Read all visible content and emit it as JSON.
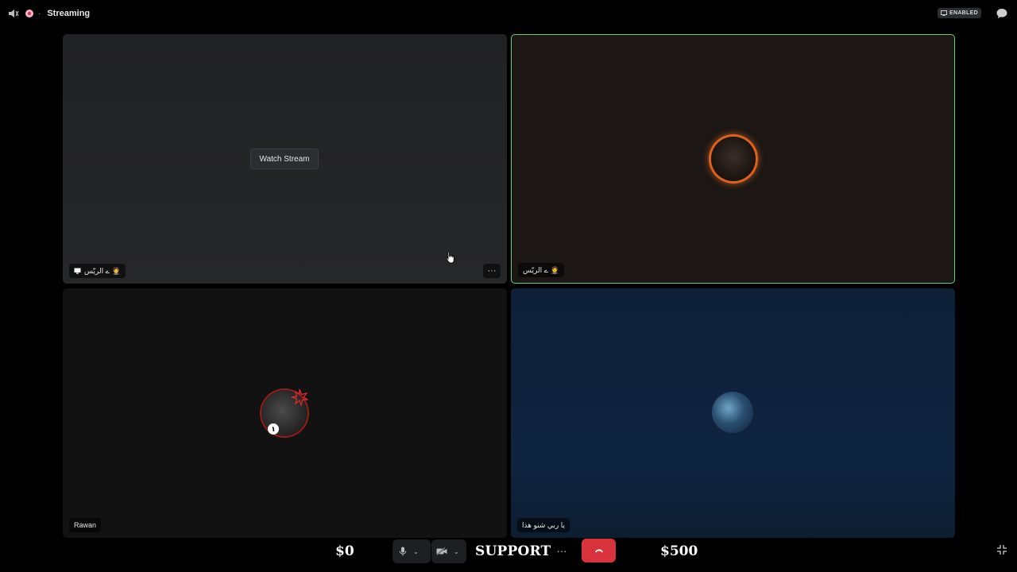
{
  "topbar": {
    "title": "Streaming",
    "dot": "·",
    "badge_label": "ENABLED"
  },
  "tiles": [
    {
      "name_tag": "ے الريّس 🤵",
      "watch_stream_label": "Watch Stream",
      "more_label": "···"
    },
    {
      "name_tag": "ے الريّس 🤵"
    },
    {
      "name_tag": "Rawan",
      "badge": "١"
    },
    {
      "name_tag": "يا ربي شنو هذا"
    }
  ],
  "controls": {
    "money_left": "$0",
    "money_right": "$500",
    "support_label": "SUPPORT",
    "more_label": "···"
  },
  "colors": {
    "speaking_border": "#5fd37a",
    "hangup": "#d8323c"
  }
}
